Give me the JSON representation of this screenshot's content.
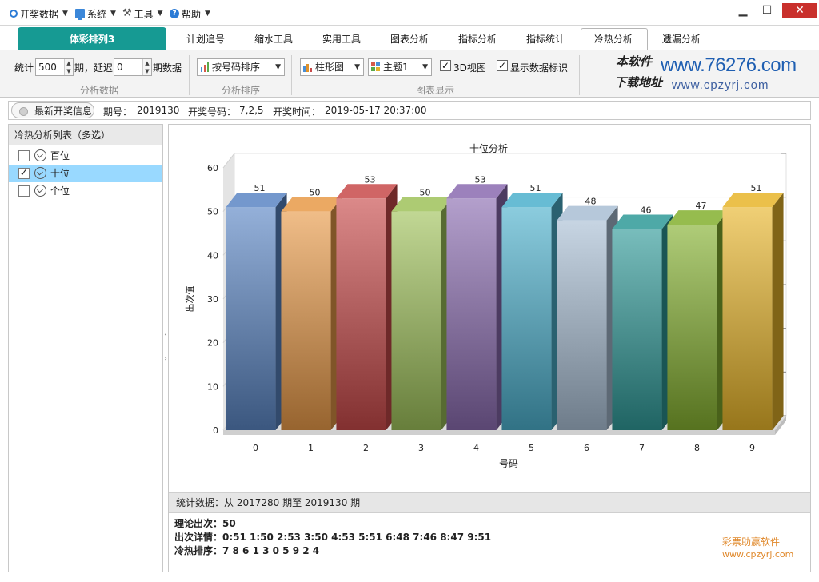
{
  "menu": {
    "items": [
      {
        "label": "开奖数据",
        "icon": "circle-icon"
      },
      {
        "label": "系统",
        "icon": "monitor-icon"
      },
      {
        "label": "工具",
        "icon": "tools-icon"
      },
      {
        "label": "帮助",
        "icon": "help-icon"
      }
    ],
    "window": {
      "minimize": "▁",
      "maximize": "☐",
      "close": "✕"
    }
  },
  "tabs": {
    "product": "体彩排列3",
    "items": [
      "计划追号",
      "缩水工具",
      "实用工具",
      "图表分析",
      "指标分析",
      "指标统计",
      "冷热分析",
      "遗漏分析"
    ],
    "active": "冷热分析"
  },
  "toolbar": {
    "stat_label": "统计",
    "stat_value": "500",
    "period_delay_label": "期，延迟",
    "delay_value": "0",
    "period_data_label": "期数据",
    "group1": "分析数据",
    "sort_combo": "按号码排序",
    "group2": "分析排序",
    "chart_type_combo": "柱形图",
    "theme_combo": "主题1",
    "view3d_label": "3D视图",
    "view3d_checked": true,
    "show_labels_label": "显示数据标识",
    "show_labels_checked": true,
    "group3": "图表显示",
    "watermark_line1": "本软件",
    "watermark_line2": "下载地址",
    "watermark_url1": "www.76276.com",
    "watermark_url2": "www.cpzyrj.com"
  },
  "infobar": {
    "button": "最新开奖信息",
    "issue_label": "期号：",
    "issue": "2019130",
    "numbers_label": "开奖号码：",
    "numbers": "7,2,5",
    "time_label": "开奖时间：",
    "time": "2019-05-17 20:37:00"
  },
  "left_panel": {
    "title": "冷热分析列表（多选）",
    "items": [
      {
        "label": "百位",
        "checked": false
      },
      {
        "label": "十位",
        "checked": true
      },
      {
        "label": "个位",
        "checked": false
      }
    ],
    "splitter_arrows": [
      "‹",
      "›"
    ]
  },
  "chart_data": {
    "type": "bar",
    "title": "十位分析",
    "xlabel": "号码",
    "ylabel": "出次值",
    "categories": [
      "0",
      "1",
      "2",
      "3",
      "4",
      "5",
      "6",
      "7",
      "8",
      "9"
    ],
    "values": [
      51,
      50,
      53,
      50,
      53,
      51,
      48,
      46,
      47,
      51
    ],
    "ylim": [
      0,
      60
    ],
    "yticks": [
      0,
      10,
      20,
      30,
      40,
      50,
      60
    ],
    "grid": true,
    "view_3d": true,
    "data_labels": true,
    "colors": [
      "#5b86c4",
      "#e89a48",
      "#c84a4a",
      "#9fc25a",
      "#8a6bb0",
      "#4cb0cc",
      "#a9bed4",
      "#2f9a98",
      "#84b02f",
      "#e8b52a"
    ]
  },
  "stats": {
    "header": "统计数据：从 2017280 期至 2019130 期",
    "theory": "理论出次：50",
    "details": "出次详情：0:51    1:50    2:53    3:50    4:53    5:51    6:48    7:46    8:47    9:51",
    "ranking": "冷热排序：7    8    6    1    3    0    5    9    2    4"
  },
  "brand": {
    "name": "彩票助赢软件",
    "url": "www.cpzyrj.com"
  }
}
